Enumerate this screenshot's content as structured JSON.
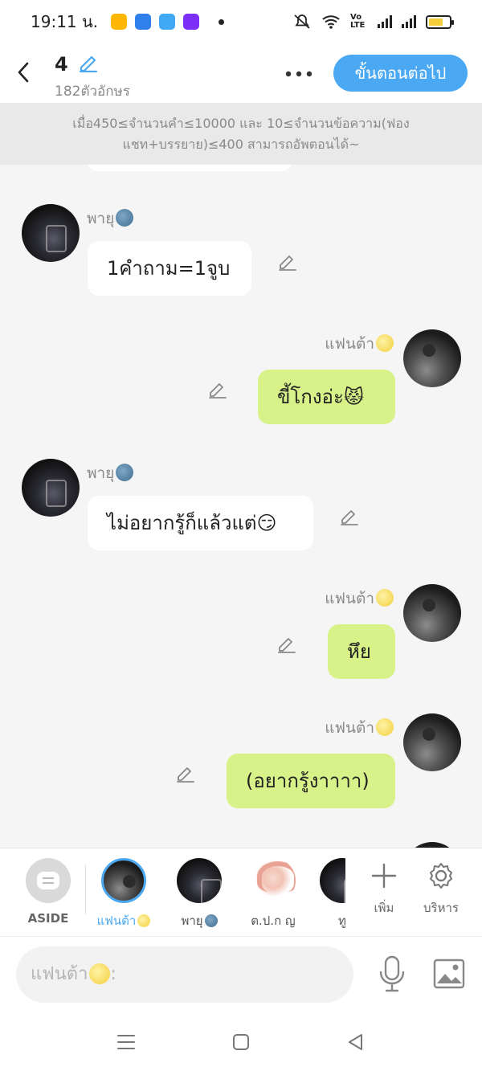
{
  "status": {
    "time": "19:11 น.",
    "network": "Vo LTE",
    "app_icon_colors": [
      "#ffb703",
      "#2f80ed",
      "#3fa9f5",
      "#7b2ff7"
    ]
  },
  "header": {
    "title": "4",
    "char_count": "182ตัวอักษร",
    "next_label": "ขั้นตอนต่อไป",
    "accent": "#4ba8f2"
  },
  "notice": {
    "text": "เมื่อ450≤จำนวนคำ≤10000 และ 10≤จำนวนข้อความ(ฟองแชท+บรรยาย)≤400 สามารถอัพตอนได้~"
  },
  "messages": [
    {
      "side": "left",
      "sender": "พายุ",
      "text": "1คำถาม=1จูบ"
    },
    {
      "side": "right",
      "sender": "แฟนต้า",
      "text": "ขี้โกงอ่ะ😾"
    },
    {
      "side": "left",
      "sender": "พายุ",
      "text": "ไม่อยากรู้ก็แล้วแต่😏"
    },
    {
      "side": "right",
      "sender": "แฟนต้า",
      "text": "หึย"
    },
    {
      "side": "right",
      "sender": "แฟนต้า",
      "text": "(อยากรู้งาาาา)"
    }
  ],
  "characters": [
    {
      "label": "ASIDE"
    },
    {
      "label": "แฟนต้า",
      "selected": true
    },
    {
      "label": "พายุ"
    },
    {
      "label": "ต.ป.ก ญ"
    },
    {
      "label": "ทู"
    }
  ],
  "tools": {
    "add_label": "เพิ่ม",
    "manage_label": "บริหาร"
  },
  "input": {
    "placeholder": "แฟนต้า"
  },
  "colors": {
    "bubble_right": "#d8f28a",
    "bubble_left": "#ffffff",
    "background": "#f5f5f5"
  }
}
